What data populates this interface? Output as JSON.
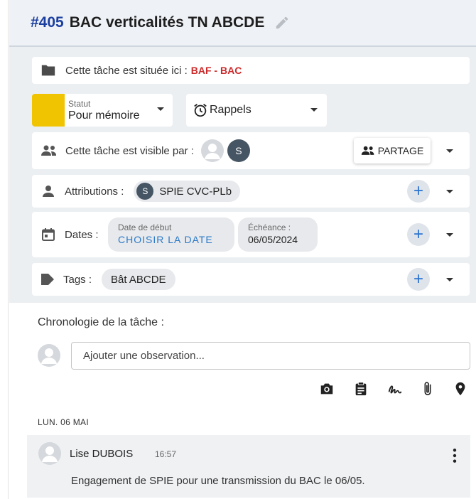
{
  "header": {
    "task_number": "#405",
    "title": "BAC verticalités TN ABCDE"
  },
  "location": {
    "label": "Cette tâche est située ici :",
    "value": "BAF - BAC"
  },
  "status": {
    "label": "Statut",
    "value": "Pour mémoire",
    "color": "#f0c400"
  },
  "reminders": {
    "label": "Rappels"
  },
  "visibility": {
    "label": "Cette tâche est visible par :",
    "avatar_initial": "S",
    "share_label": "PARTAGE"
  },
  "attributions": {
    "label": "Attributions :",
    "chip_initial": "S",
    "chip_label": "SPIE CVC-PLb"
  },
  "dates": {
    "label": "Dates :",
    "start_small": "Date de début",
    "start_value": "CHOISIR LA DATE",
    "due_small": "Échéance :",
    "due_value": "06/05/2024"
  },
  "tags": {
    "label": "Tags :",
    "chip": "Bât ABCDE"
  },
  "chronology": {
    "title": "Chronologie de la tâche :",
    "input_placeholder": "Ajouter une observation...",
    "tools": [
      "camera-icon",
      "clipboard-icon",
      "signature-icon",
      "paperclip-icon",
      "location-pin-icon"
    ],
    "day": "LUN. 06 MAI",
    "entry": {
      "author": "Lise DUBOIS",
      "time": "16:57",
      "text": "Engagement de SPIE pour une transmission du BAC le 06/05."
    }
  }
}
